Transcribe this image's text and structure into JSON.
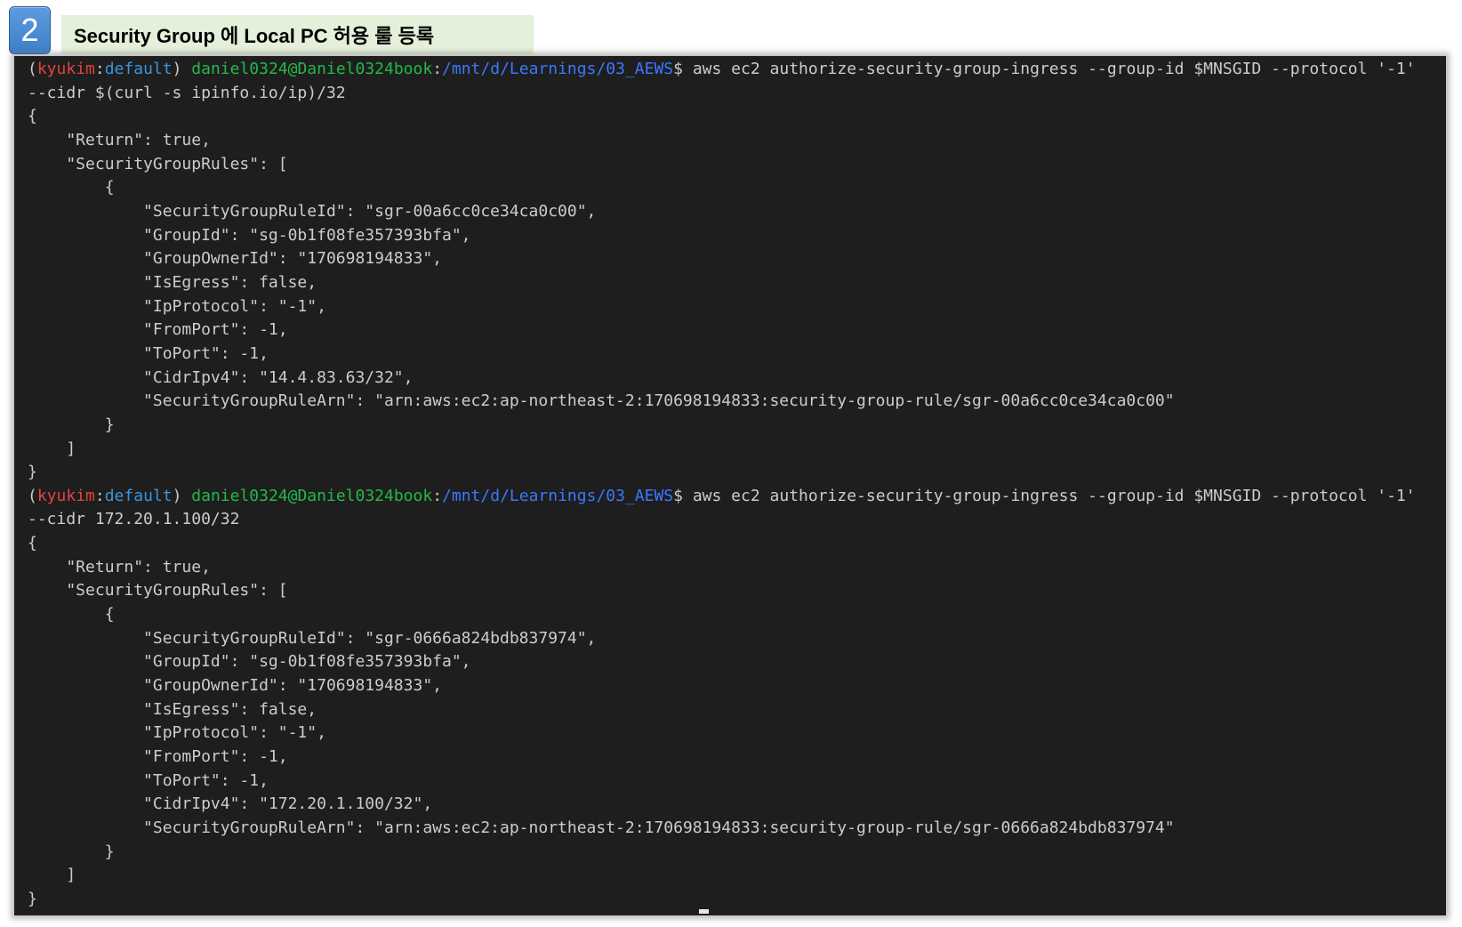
{
  "header": {
    "step_number": "2",
    "title": "Security Group 에 Local PC 허용 룰 등록",
    "badge_color": "#3f7fc6",
    "title_background": "#e4f0da"
  },
  "terminal": {
    "colors": {
      "background": "#1e1e1e",
      "text": "#cccccc",
      "env": "#e0443e",
      "profile": "#3a96dd",
      "user_host": "#23b94a",
      "path": "#3b78ff"
    },
    "blocks": [
      {
        "prompt": {
          "open": "(",
          "env": "kyukim",
          "sep": ":",
          "profile": "default",
          "close": ")",
          "user_host": "daniel0324@Daniel0324book",
          "path_sep": ":",
          "path": "/mnt/d/Learnings/03_AEWS",
          "symbol": "$"
        },
        "command": "aws ec2 authorize-security-group-ingress --group-id $MNSGID --protocol '-1'",
        "command_wrap": "--cidr $(curl -s ipinfo.io/ip)/32",
        "output": [
          "{",
          "    \"Return\": true,",
          "    \"SecurityGroupRules\": [",
          "        {",
          "            \"SecurityGroupRuleId\": \"sgr-00a6cc0ce34ca0c00\",",
          "            \"GroupId\": \"sg-0b1f08fe357393bfa\",",
          "            \"GroupOwnerId\": \"170698194833\",",
          "            \"IsEgress\": false,",
          "            \"IpProtocol\": \"-1\",",
          "            \"FromPort\": -1,",
          "            \"ToPort\": -1,",
          "            \"CidrIpv4\": \"14.4.83.63/32\",",
          "            \"SecurityGroupRuleArn\": \"arn:aws:ec2:ap-northeast-2:170698194833:security-group-rule/sgr-00a6cc0ce34ca0c00\"",
          "        }",
          "    ]",
          "}"
        ]
      },
      {
        "prompt": {
          "open": "(",
          "env": "kyukim",
          "sep": ":",
          "profile": "default",
          "close": ")",
          "user_host": "daniel0324@Daniel0324book",
          "path_sep": ":",
          "path": "/mnt/d/Learnings/03_AEWS",
          "symbol": "$"
        },
        "command": "aws ec2 authorize-security-group-ingress --group-id $MNSGID --protocol '-1'",
        "command_wrap": "--cidr 172.20.1.100/32",
        "output": [
          "{",
          "    \"Return\": true,",
          "    \"SecurityGroupRules\": [",
          "        {",
          "            \"SecurityGroupRuleId\": \"sgr-0666a824bdb837974\",",
          "            \"GroupId\": \"sg-0b1f08fe357393bfa\",",
          "            \"GroupOwnerId\": \"170698194833\",",
          "            \"IsEgress\": false,",
          "            \"IpProtocol\": \"-1\",",
          "            \"FromPort\": -1,",
          "            \"ToPort\": -1,",
          "            \"CidrIpv4\": \"172.20.1.100/32\",",
          "            \"SecurityGroupRuleArn\": \"arn:aws:ec2:ap-northeast-2:170698194833:security-group-rule/sgr-0666a824bdb837974\"",
          "        }",
          "    ]",
          "}"
        ]
      }
    ]
  }
}
